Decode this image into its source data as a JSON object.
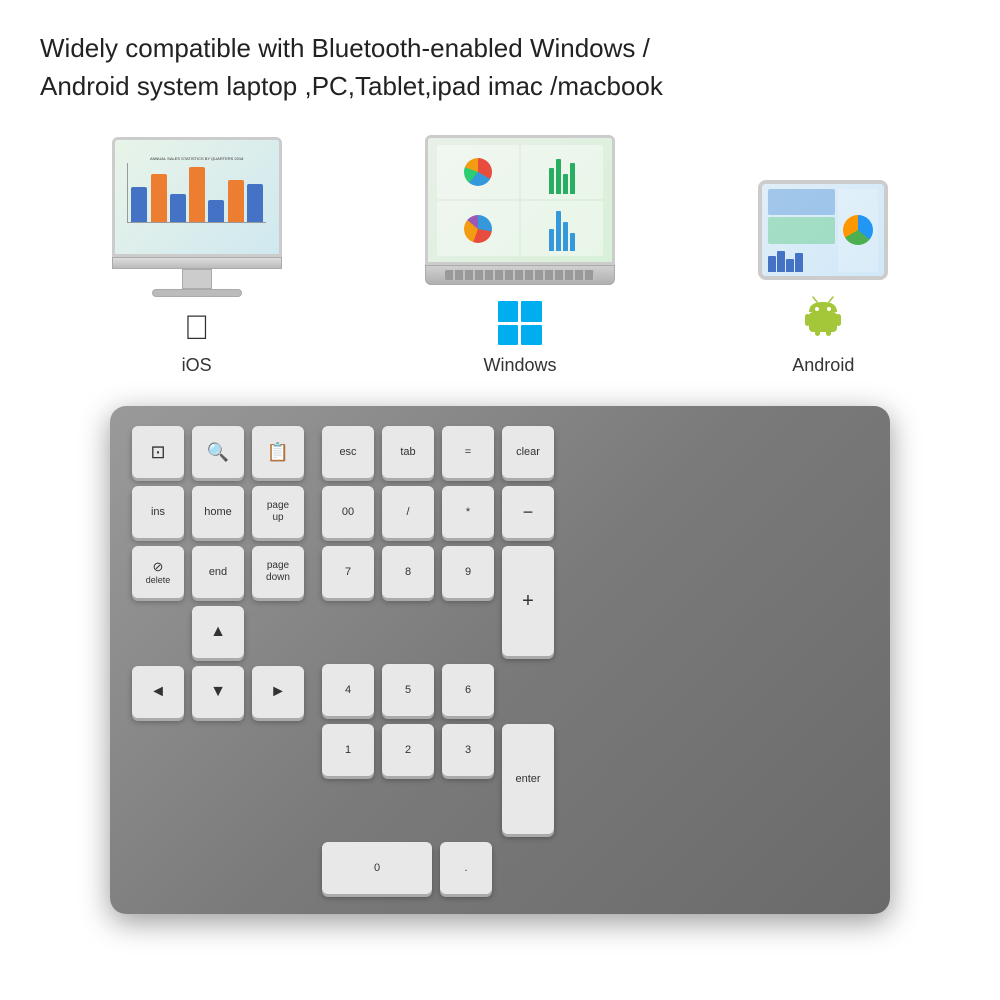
{
  "header": {
    "text_line1": "Widely compatible with Bluetooth-enabled Windows /",
    "text_line2": "Android system laptop ,PC,Tablet,ipad imac /macbook"
  },
  "devices": [
    {
      "id": "ios",
      "label": "iOS",
      "type": "imac"
    },
    {
      "id": "windows",
      "label": "Windows",
      "type": "laptop"
    },
    {
      "id": "android",
      "label": "Android",
      "type": "tablet"
    }
  ],
  "keyboard": {
    "left_keys": [
      [
        {
          "label": "",
          "icon": "🖼️",
          "size": "sq",
          "name": "fn-key"
        },
        {
          "label": "",
          "icon": "🔍",
          "size": "sq",
          "name": "search-key"
        },
        {
          "label": "",
          "icon": "📅",
          "size": "sq",
          "name": "calendar-key"
        }
      ],
      [
        {
          "label": "ins",
          "size": "sq",
          "name": "ins-key"
        },
        {
          "label": "home",
          "size": "sq",
          "name": "home-key"
        },
        {
          "label": "page\nup",
          "size": "sq",
          "name": "pageup-key"
        }
      ],
      [
        {
          "label": "delete",
          "icon": "🖊",
          "size": "sq",
          "name": "delete-key"
        },
        {
          "label": "end",
          "size": "sq",
          "name": "end-key"
        },
        {
          "label": "page\ndown",
          "size": "sq",
          "name": "pagedown-key"
        }
      ],
      [
        {
          "label": "▲",
          "size": "sq",
          "name": "up-arrow-key",
          "col_offset": 1
        }
      ],
      [
        {
          "label": "◄",
          "size": "sq",
          "name": "left-arrow-key"
        },
        {
          "label": "▼",
          "size": "sq",
          "name": "down-arrow-key"
        },
        {
          "label": "►",
          "size": "sq",
          "name": "right-arrow-key"
        }
      ]
    ],
    "right_keys": {
      "row1": [
        {
          "label": "esc",
          "name": "esc-key"
        },
        {
          "label": "tab",
          "name": "tab-key"
        },
        {
          "label": "=",
          "name": "equals-key"
        },
        {
          "label": "clear",
          "name": "clear-key"
        }
      ],
      "row2": [
        {
          "label": "00",
          "name": "double-zero-key"
        },
        {
          "label": "/",
          "name": "divide-key"
        },
        {
          "label": "*",
          "name": "multiply-key"
        },
        {
          "label": "−",
          "name": "minus-key"
        }
      ],
      "row3_nums": [
        {
          "label": "7",
          "name": "key-7"
        },
        {
          "label": "8",
          "name": "key-8"
        },
        {
          "label": "9",
          "name": "key-9"
        }
      ],
      "plus_key": {
        "label": "+",
        "name": "plus-key"
      },
      "row4_nums": [
        {
          "label": "4",
          "name": "key-4"
        },
        {
          "label": "5",
          "name": "key-5"
        },
        {
          "label": "6",
          "name": "key-6"
        }
      ],
      "row5_nums": [
        {
          "label": "1",
          "name": "key-1"
        },
        {
          "label": "2",
          "name": "key-2"
        },
        {
          "label": "3",
          "name": "key-3"
        }
      ],
      "zero_key": {
        "label": "0",
        "name": "key-0"
      },
      "dot_key": {
        "label": ".",
        "name": "dot-key"
      },
      "enter_key": {
        "label": "enter",
        "name": "enter-key"
      }
    }
  }
}
